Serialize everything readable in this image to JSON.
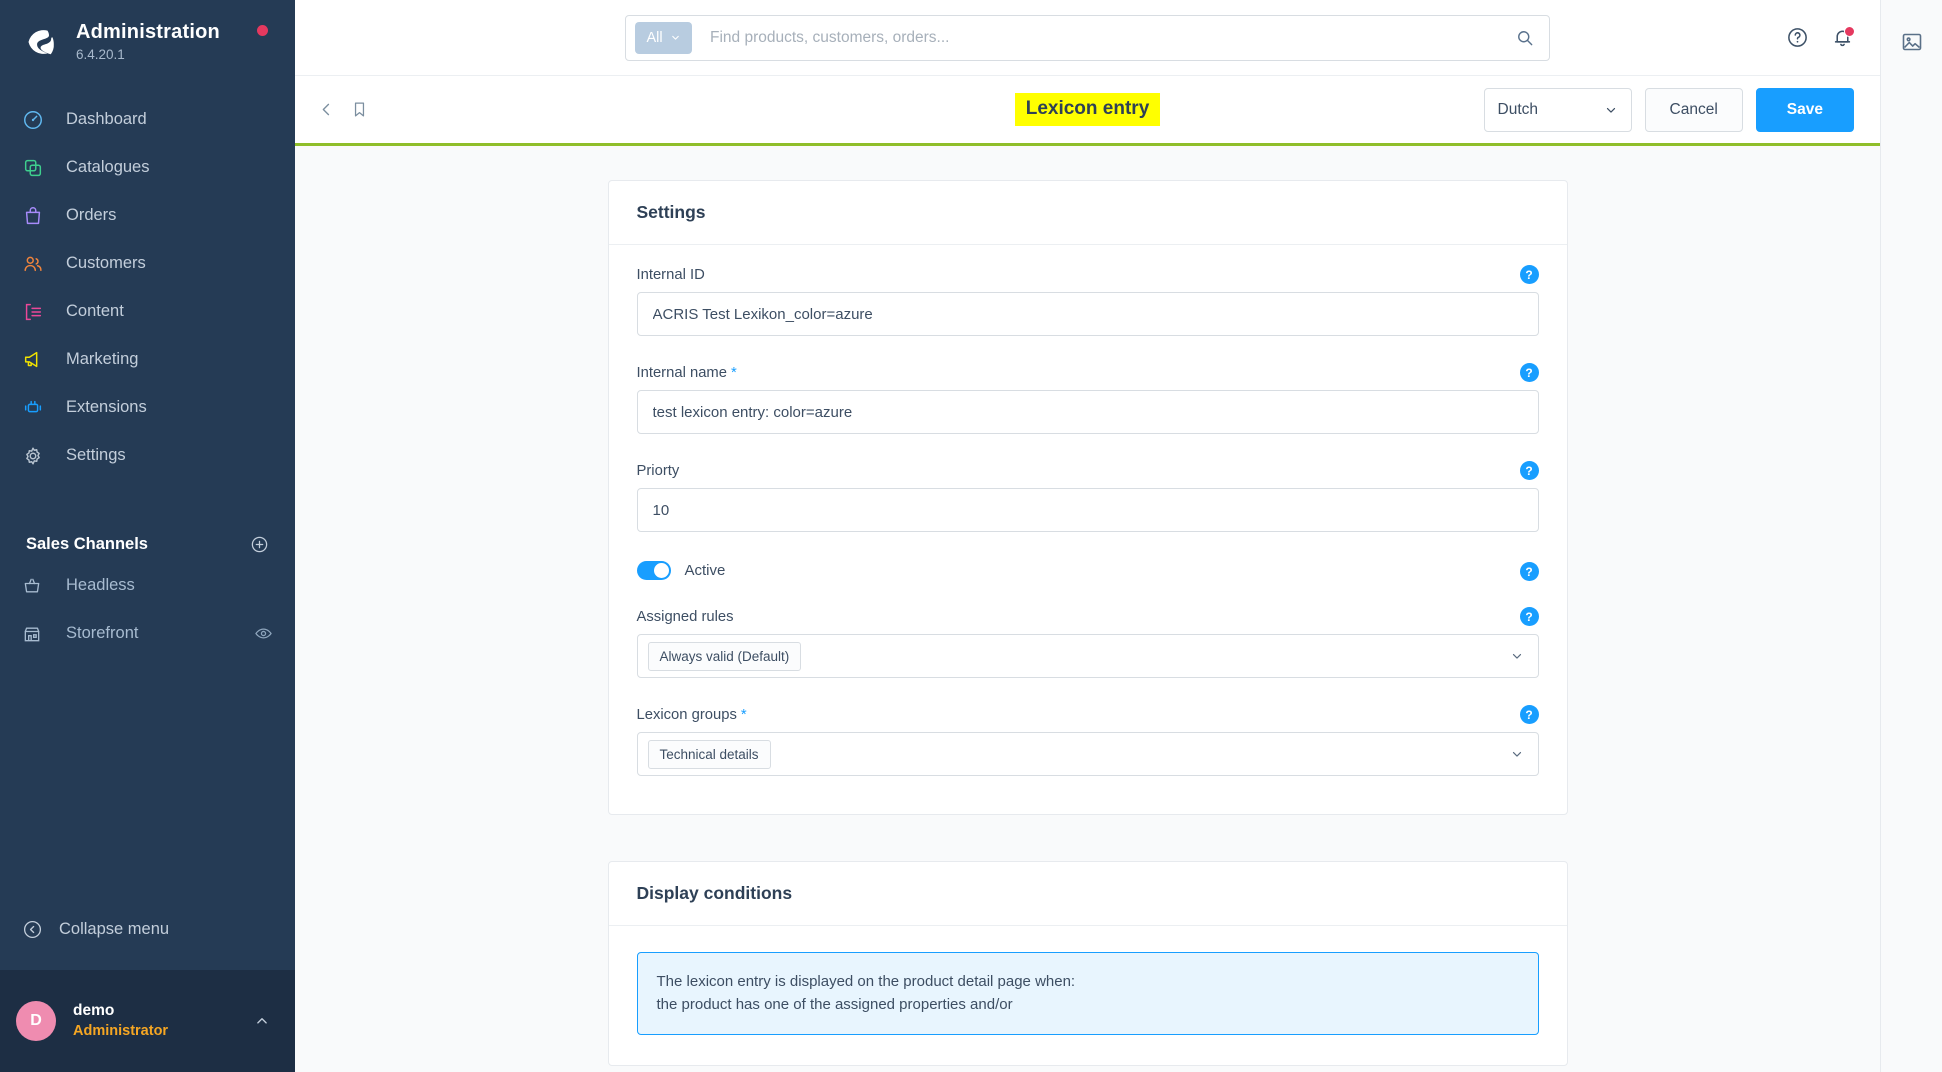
{
  "sidebar": {
    "brand": {
      "title": "Administration",
      "version": "6.4.20.1",
      "logo_icon": "shopware-logo-icon",
      "status_dot": "update-available-dot"
    },
    "nav": [
      {
        "label": "Dashboard",
        "icon": "dashboard-icon",
        "color": "#60b8f0"
      },
      {
        "label": "Catalogues",
        "icon": "catalogues-icon",
        "color": "#3ecf8e"
      },
      {
        "label": "Orders",
        "icon": "orders-icon",
        "color": "#a78bfa"
      },
      {
        "label": "Customers",
        "icon": "customers-icon",
        "color": "#f0843c"
      },
      {
        "label": "Content",
        "icon": "content-icon",
        "color": "#ec4899"
      },
      {
        "label": "Marketing",
        "icon": "marketing-icon",
        "color": "#f2e300"
      },
      {
        "label": "Extensions",
        "icon": "extensions-icon",
        "color": "#189eff"
      },
      {
        "label": "Settings",
        "icon": "settings-gear-icon",
        "color": "#b6c2cf"
      }
    ],
    "sales_channels": {
      "title": "Sales Channels",
      "add_icon": "plus-circle-icon",
      "items": [
        {
          "label": "Headless",
          "icon": "basket-icon",
          "trailing_icon": ""
        },
        {
          "label": "Storefront",
          "icon": "storefront-icon",
          "trailing_icon": "eye-icon"
        }
      ]
    },
    "collapse": {
      "label": "Collapse menu",
      "icon": "chevron-left-circle-icon"
    },
    "user": {
      "initial": "D",
      "name": "demo",
      "role": "Administrator",
      "caret_icon": "chevron-up-icon"
    }
  },
  "topbar": {
    "search": {
      "scope_label": "All",
      "scope_caret_icon": "chevron-down-icon",
      "placeholder": "Find products, customers, orders...",
      "value": "",
      "search_icon": "search-icon"
    },
    "help_icon": "help-circle-icon",
    "notifications_icon": "bell-icon"
  },
  "toolbar": {
    "back_icon": "chevron-left-icon",
    "bookmark_icon": "bookmark-icon",
    "title": "Lexicon entry",
    "title_highlight_color": "#ffff00",
    "accent_border_color": "#8fbe2a",
    "language": {
      "value": "Dutch",
      "caret_icon": "chevron-down-icon"
    },
    "cancel_label": "Cancel",
    "save_label": "Save",
    "save_color": "#189eff"
  },
  "settings_card": {
    "title": "Settings",
    "fields": {
      "internal_id": {
        "label": "Internal ID",
        "value": "ACRIS Test Lexikon_color=azure",
        "required": false,
        "help_icon": "help-badge-icon"
      },
      "internal_name": {
        "label": "Internal name",
        "value": "test lexicon entry: color=azure",
        "required": true,
        "required_mark": "*",
        "help_icon": "help-badge-icon"
      },
      "priority": {
        "label": "Priorty",
        "value": "10",
        "required": false,
        "help_icon": "help-badge-icon"
      },
      "active": {
        "label": "Active",
        "checked": true,
        "help_icon": "help-badge-icon"
      },
      "assigned_rules": {
        "label": "Assigned rules",
        "required": false,
        "chips": [
          "Always valid (Default)"
        ],
        "caret_icon": "chevron-down-icon",
        "help_icon": "help-badge-icon"
      },
      "lexicon_groups": {
        "label": "Lexicon groups",
        "required": true,
        "required_mark": "*",
        "chips": [
          "Technical details"
        ],
        "caret_icon": "chevron-down-icon",
        "help_icon": "help-badge-icon"
      }
    }
  },
  "display_conditions_card": {
    "title": "Display conditions",
    "hint_line_1": "The lexicon entry is displayed on the product detail page when:",
    "hint_line_2": "the product has one of the assigned properties and/or"
  },
  "rightrail": {
    "media_icon": "image-media-icon"
  }
}
